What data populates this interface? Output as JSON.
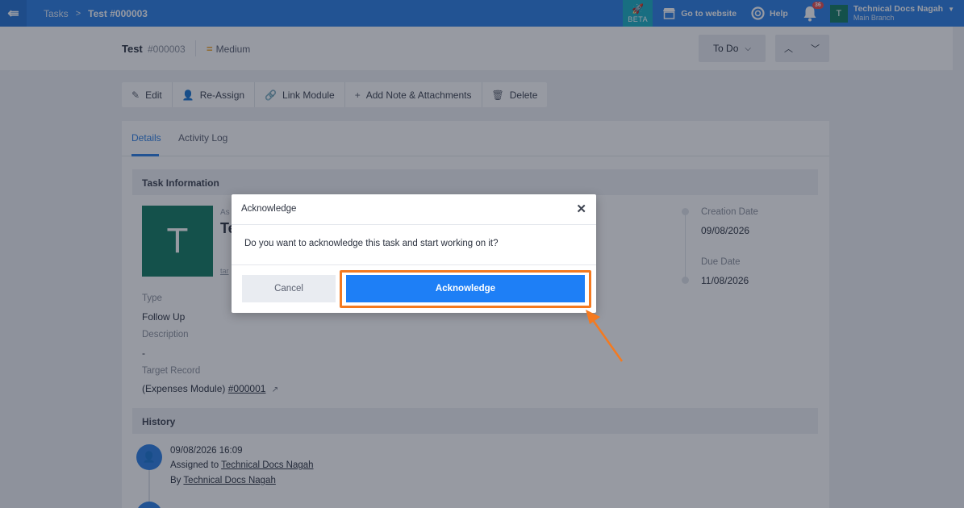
{
  "topbar": {
    "breadcrumb": [
      "Tasks",
      "Test #000003"
    ],
    "beta_label": "BETA",
    "goto_website": "Go to website",
    "help": "Help",
    "notif_count": "36",
    "user_initial": "T",
    "user_name": "Technical Docs Nagah",
    "branch": "Main Branch"
  },
  "header": {
    "title": "Test",
    "number": "#000003",
    "priority": "Medium",
    "status": "To Do"
  },
  "toolbar": {
    "edit": "Edit",
    "reassign": "Re-Assign",
    "link_module": "Link Module",
    "add_note": "Add Note & Attachments",
    "delete": "Delete"
  },
  "tabs": {
    "details": "Details",
    "activity": "Activity Log"
  },
  "task_info": {
    "heading": "Task Information",
    "avatar_initial": "T",
    "frag_assignee_label": "As",
    "frag_assignee_name": "Te",
    "frag_link": "tar",
    "type_label": "Type",
    "type_value": "Follow Up",
    "description_label": "Description",
    "description_value": "-",
    "target_label": "Target Record",
    "target_prefix": "(Expenses Module)",
    "target_link": "#000001",
    "creation_label": "Creation Date",
    "creation_value": "09/08/2026",
    "due_label": "Due Date",
    "due_value": "11/08/2026"
  },
  "history": {
    "heading": "History",
    "entry_time": "09/08/2026 16:09",
    "assigned_to_prefix": "Assigned to",
    "assigned_to_name": "Technical Docs Nagah",
    "by_prefix": "By",
    "by_name": "Technical Docs Nagah"
  },
  "modal": {
    "title": "Acknowledge",
    "message": "Do you want to acknowledge this task and start working on it?",
    "cancel": "Cancel",
    "acknowledge": "Acknowledge"
  },
  "colors": {
    "primary": "#2b7ee3",
    "accent_highlight": "#f47a20",
    "avatar_green": "#117a61",
    "beta": "#19b0c4"
  }
}
